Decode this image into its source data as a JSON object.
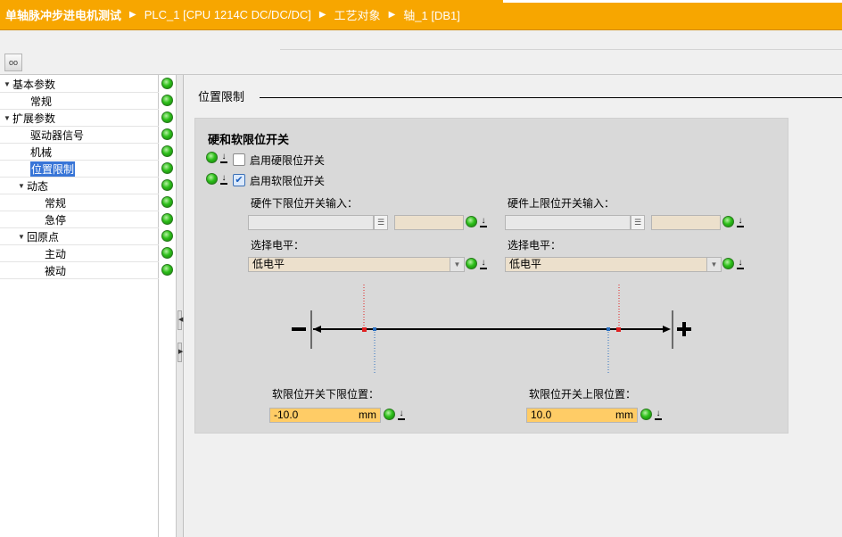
{
  "breadcrumb": [
    "单轴脉冲步进电机测试",
    "PLC_1 [CPU 1214C DC/DC/DC]",
    "工艺对象",
    "轴_1 [DB1]"
  ],
  "toolbar": {
    "glasses_label": "oo"
  },
  "tree": {
    "items": [
      {
        "label": "基本参数",
        "expanded": true,
        "level": 0
      },
      {
        "label": "常规",
        "level": 1
      },
      {
        "label": "扩展参数",
        "expanded": true,
        "level": 0
      },
      {
        "label": "驱动器信号",
        "level": 1
      },
      {
        "label": "机械",
        "level": 1
      },
      {
        "label": "位置限制",
        "level": 1,
        "selected": true
      },
      {
        "label": "动态",
        "expanded": true,
        "level": 1
      },
      {
        "label": "常规",
        "level": 2
      },
      {
        "label": "急停",
        "level": 2
      },
      {
        "label": "回原点",
        "expanded": true,
        "level": 1
      },
      {
        "label": "主动",
        "level": 2
      },
      {
        "label": "被动",
        "level": 2
      }
    ]
  },
  "section": {
    "title": "位置限制"
  },
  "panel": {
    "heading": "硬和软限位开关",
    "enable_hw_label": "启用硬限位开关",
    "enable_hw_checked": false,
    "enable_sw_label": "启用软限位开关",
    "enable_sw_checked": true,
    "hw_lower_input_label": "硬件下限位开关输入：",
    "hw_upper_input_label": "硬件上限位开关输入：",
    "hw_lower_input_value": "",
    "hw_upper_input_value": "",
    "level_label_left": "选择电平：",
    "level_label_right": "选择电平：",
    "level_left_value": "低电平",
    "level_right_value": "低电平",
    "minus_sign": "−",
    "plus_sign": "+",
    "sw_lower_label": "软限位开关下限位置：",
    "sw_upper_label": "软限位开关上限位置：",
    "sw_lower_value": "-10.0",
    "sw_upper_value": "10.0",
    "unit": "mm"
  },
  "colors": {
    "titlebar": "#f7a600",
    "ok_status": "#2dbf1a",
    "hw_limit_marker": "#e02020",
    "sw_limit_marker": "#2a6fc0",
    "value_field": "#ffcc66"
  }
}
